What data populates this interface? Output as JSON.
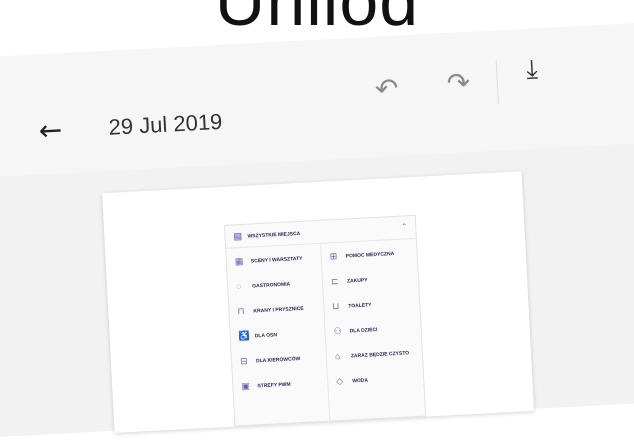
{
  "banner": {
    "text": "Unilod"
  },
  "toolbar": {
    "date": "29 Jul 2019",
    "icons": [
      "back-arrow-icon",
      "undo-icon",
      "redo-icon",
      "download-icon"
    ]
  },
  "panel": {
    "title": "WSZYSTKIE MIEJSCA",
    "left_items": [
      {
        "label": "SCENY I WARSZTATY",
        "icon": "stage-icon"
      },
      {
        "label": "GASTRONOMIA",
        "icon": "food-icon"
      },
      {
        "label": "KRANY I PRYSZNICE",
        "icon": "shower-icon"
      },
      {
        "label": "DLA OSN",
        "icon": "accessibility-icon"
      },
      {
        "label": "DLA KIEROWCÓW",
        "icon": "car-icon"
      },
      {
        "label": "STREFY PWM",
        "icon": "zone-icon"
      }
    ],
    "right_items": [
      {
        "label": "POMOC MEDYCZNA",
        "icon": "medical-icon"
      },
      {
        "label": "ZAKUPY",
        "icon": "shopping-icon"
      },
      {
        "label": "TOALETY",
        "icon": "toilet-icon"
      },
      {
        "label": "DLA DZIECI",
        "icon": "kids-icon"
      },
      {
        "label": "ZARAZ BĘDZIE CZYSTO",
        "icon": "cleaning-icon"
      },
      {
        "label": "WODA",
        "icon": "water-icon"
      }
    ]
  }
}
